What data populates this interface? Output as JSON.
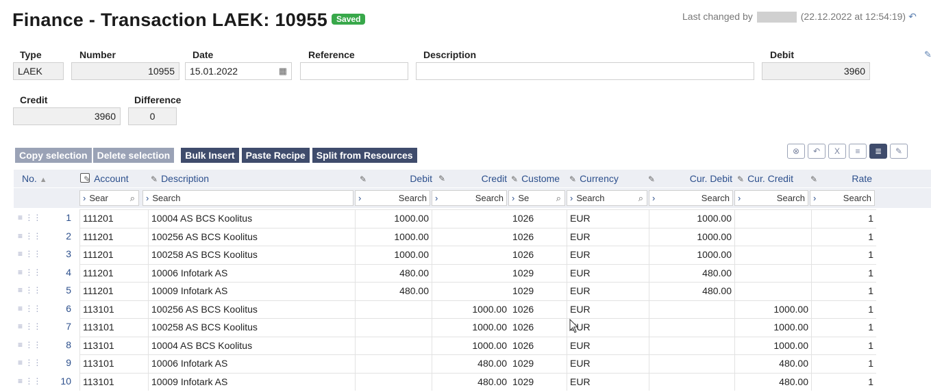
{
  "page": {
    "title": "Finance - Transaction LAEK: 10955",
    "status_badge": "Saved",
    "last_changed_label": "Last changed by",
    "last_changed_when": "(22.12.2022 at 12:54:19)"
  },
  "form": {
    "type_label": "Type",
    "type_value": "LAEK",
    "number_label": "Number",
    "number_value": "10955",
    "date_label": "Date",
    "date_value": "15.01.2022",
    "reference_label": "Reference",
    "reference_value": "",
    "description_label": "Description",
    "description_value": "",
    "debit_label": "Debit",
    "debit_value": "3960",
    "credit_label": "Credit",
    "credit_value": "3960",
    "difference_label": "Difference",
    "difference_value": "0"
  },
  "toolbar": {
    "copy_selection": "Copy selection",
    "delete_selection": "Delete selection",
    "bulk_insert": "Bulk Insert",
    "paste_recipe": "Paste Recipe",
    "split_from_resources": "Split from Resources"
  },
  "table": {
    "headers": {
      "no": "No.",
      "account": "Account",
      "description": "Description",
      "debit": "Debit",
      "credit": "Credit",
      "customer": "Custome",
      "currency": "Currency",
      "cur_debit": "Cur. Debit",
      "cur_credit": "Cur. Credit",
      "rate": "Rate"
    },
    "filters": {
      "account": "Sear",
      "description": "Search",
      "debit": "Search",
      "credit": "Search",
      "customer": "Se",
      "currency": "Search",
      "cur_debit": "Search",
      "cur_credit": "Search",
      "rate": "Search"
    },
    "rows": [
      {
        "no": "1",
        "account": "111201",
        "description": "10004 AS BCS Koolitus",
        "debit": "1000.00",
        "credit": "",
        "customer": "1026",
        "currency": "EUR",
        "cur_debit": "1000.00",
        "cur_credit": "",
        "rate": "1"
      },
      {
        "no": "2",
        "account": "111201",
        "description": "100256 AS BCS Koolitus",
        "debit": "1000.00",
        "credit": "",
        "customer": "1026",
        "currency": "EUR",
        "cur_debit": "1000.00",
        "cur_credit": "",
        "rate": "1"
      },
      {
        "no": "3",
        "account": "111201",
        "description": "100258 AS BCS Koolitus",
        "debit": "1000.00",
        "credit": "",
        "customer": "1026",
        "currency": "EUR",
        "cur_debit": "1000.00",
        "cur_credit": "",
        "rate": "1"
      },
      {
        "no": "4",
        "account": "111201",
        "description": "10006 Infotark AS",
        "debit": "480.00",
        "credit": "",
        "customer": "1029",
        "currency": "EUR",
        "cur_debit": "480.00",
        "cur_credit": "",
        "rate": "1"
      },
      {
        "no": "5",
        "account": "111201",
        "description": "10009 Infotark AS",
        "debit": "480.00",
        "credit": "",
        "customer": "1029",
        "currency": "EUR",
        "cur_debit": "480.00",
        "cur_credit": "",
        "rate": "1"
      },
      {
        "no": "6",
        "account": "113101",
        "description": "100256 AS BCS Koolitus",
        "debit": "",
        "credit": "1000.00",
        "customer": "1026",
        "currency": "EUR",
        "cur_debit": "",
        "cur_credit": "1000.00",
        "rate": "1"
      },
      {
        "no": "7",
        "account": "113101",
        "description": "100258 AS BCS Koolitus",
        "debit": "",
        "credit": "1000.00",
        "customer": "1026",
        "currency": "EUR",
        "cur_debit": "",
        "cur_credit": "1000.00",
        "rate": "1"
      },
      {
        "no": "8",
        "account": "113101",
        "description": "10004 AS BCS Koolitus",
        "debit": "",
        "credit": "1000.00",
        "customer": "1026",
        "currency": "EUR",
        "cur_debit": "",
        "cur_credit": "1000.00",
        "rate": "1"
      },
      {
        "no": "9",
        "account": "113101",
        "description": "10006 Infotark AS",
        "debit": "",
        "credit": "480.00",
        "customer": "1029",
        "currency": "EUR",
        "cur_debit": "",
        "cur_credit": "480.00",
        "rate": "1"
      },
      {
        "no": "10",
        "account": "113101",
        "description": "10009 Infotark AS",
        "debit": "",
        "credit": "480.00",
        "customer": "1029",
        "currency": "EUR",
        "cur_debit": "",
        "cur_credit": "480.00",
        "rate": "1"
      }
    ]
  }
}
